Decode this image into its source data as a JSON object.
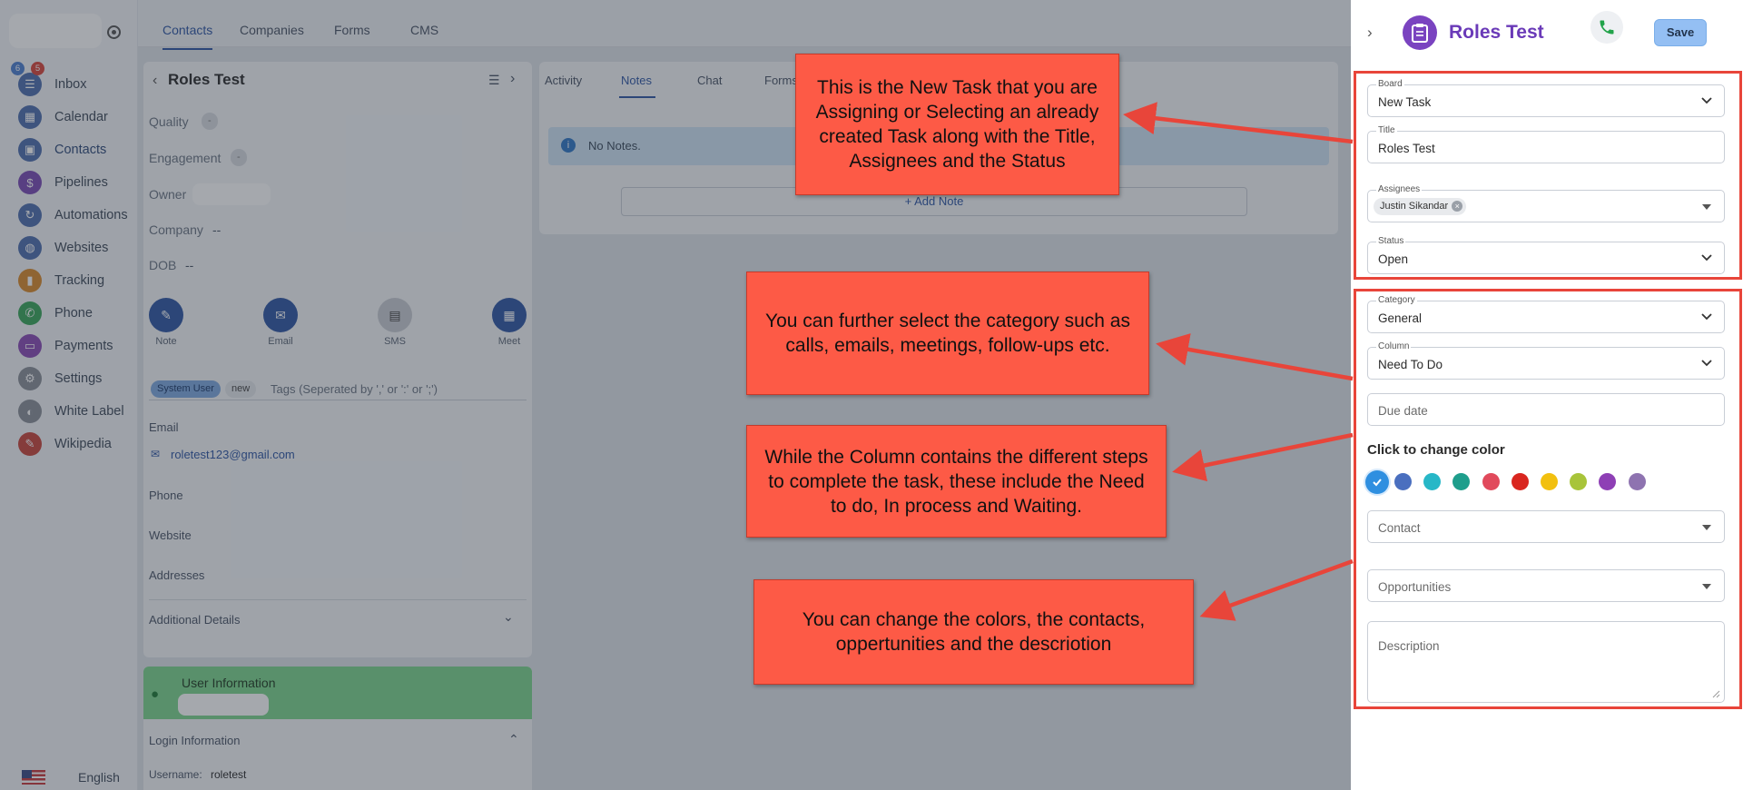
{
  "sidebar": {
    "inbox_badges": [
      "6",
      "5"
    ],
    "items": [
      {
        "label": "Inbox",
        "icon": "inbox-icon",
        "color": "#4f6fae"
      },
      {
        "label": "Calendar",
        "icon": "calendar-icon",
        "color": "#4f6fae"
      },
      {
        "label": "Contacts",
        "icon": "contacts-icon",
        "color": "#4f6fae"
      },
      {
        "label": "Pipelines",
        "icon": "dollar-icon",
        "color": "#7a4bb5"
      },
      {
        "label": "Automations",
        "icon": "automation-icon",
        "color": "#4f6fae"
      },
      {
        "label": "Websites",
        "icon": "globe-icon",
        "color": "#4f6fae"
      },
      {
        "label": "Tracking",
        "icon": "chart-icon",
        "color": "#2f9f8f"
      },
      {
        "label": "Phone",
        "icon": "phone-icon",
        "color": "#3aa65a"
      },
      {
        "label": "Payments",
        "icon": "payments-icon",
        "color": "#8a4bb5"
      },
      {
        "label": "Settings",
        "icon": "gear-icon",
        "color": "#8a8f98"
      },
      {
        "label": "White Label",
        "icon": "palette-icon",
        "color": "#8a8f98"
      },
      {
        "label": "Wikipedia",
        "icon": "edit-icon",
        "color": "#c9453c"
      }
    ],
    "language": "English"
  },
  "top_tabs": [
    "Contacts",
    "Companies",
    "Forms",
    "CMS"
  ],
  "contact": {
    "name": "Roles Test",
    "quality_label": "Quality",
    "engagement_label": "Engagement",
    "owner_label": "Owner",
    "company_label": "Company",
    "company_value": "--",
    "dob_label": "DOB",
    "dob_value": "--",
    "actions": [
      "Note",
      "Email",
      "SMS",
      "Meet"
    ],
    "tags": [
      "System User",
      "new"
    ],
    "tags_placeholder": "Tags (Seperated by ',' or ':' or ';')",
    "email_label": "Email",
    "email_value": "roletest123@gmail.com",
    "phone_label": "Phone",
    "website_label": "Website",
    "addresses_label": "Addresses",
    "additional_label": "Additional Details",
    "user_info_title": "User Information",
    "login_info_label": "Login Information",
    "username_label": "Username:",
    "username_value": "roletest"
  },
  "detail_tabs": [
    "Activity",
    "Notes",
    "Chat",
    "Forms"
  ],
  "notes": {
    "empty_text": "No Notes.",
    "add_note": "+ Add Note"
  },
  "drawer": {
    "title": "Roles Test",
    "save_label": "Save",
    "board": {
      "label": "Board",
      "value": "New Task"
    },
    "title_field": {
      "label": "Title",
      "value": "Roles Test"
    },
    "assignees": {
      "label": "Assignees",
      "chip": "Justin Sikandar"
    },
    "status": {
      "label": "Status",
      "value": "Open"
    },
    "category": {
      "label": "Category",
      "value": "General"
    },
    "column": {
      "label": "Column",
      "value": "Need To Do"
    },
    "due_date_placeholder": "Due date",
    "color_title": "Click to change color",
    "colors": [
      "#2f8fe0",
      "#4a6fbf",
      "#27b7c7",
      "#1e9e8c",
      "#e14a5c",
      "#d9261f",
      "#f2c00f",
      "#a8c43a",
      "#8e3fb5",
      "#8e73b0"
    ],
    "contact_placeholder": "Contact",
    "opportunities_placeholder": "Opportunities",
    "description_placeholder": "Description"
  },
  "callouts": [
    "This is the New Task that you are Assigning or Selecting an already created Task along with the Title, Assignees and the Status",
    "You can further select the category such as calls, emails, meetings, follow-ups etc.",
    "While the Column contains the different steps to complete the task, these include the Need to do, In process and Waiting.",
    "You can change the colors, the contacts, oppertunities and the descriotion"
  ]
}
